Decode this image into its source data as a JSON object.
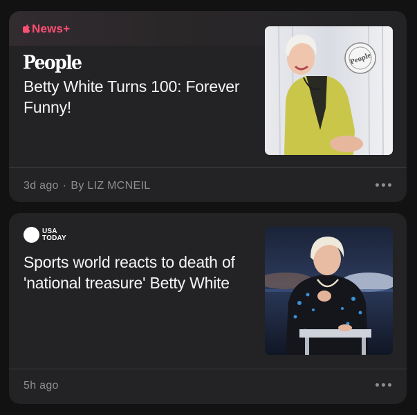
{
  "cards": [
    {
      "badge": "News+",
      "publisher": "People",
      "headline": "Betty White Turns 100: Forever Funny!",
      "time": "3d ago",
      "byline": "By LIZ MCNEIL",
      "separator": "·",
      "image_icon": "people-cover-photo",
      "more_icon": "ellipsis-icon"
    },
    {
      "publisher_line1": "USA",
      "publisher_line2": "TODAY",
      "headline": "Sports world reacts to death of 'national treasure' Betty White",
      "time": "5h ago",
      "image_icon": "stage-photo",
      "more_icon": "ellipsis-icon"
    }
  ],
  "colors": {
    "background": "#121213",
    "card": "#232325",
    "news_plus": "#ff4f73",
    "meta": "#8e8e93"
  }
}
